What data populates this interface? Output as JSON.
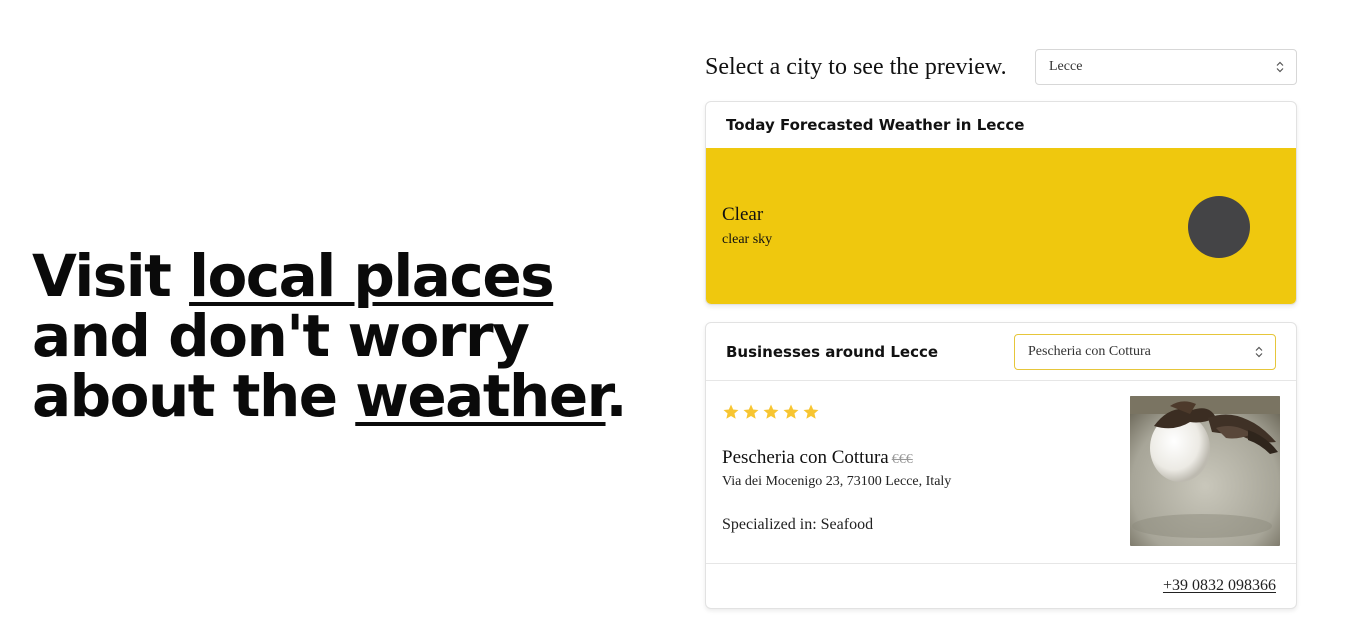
{
  "hero": {
    "line1_prefix": "Visit ",
    "line1_link": "local places",
    "line2": "and don't worry",
    "line3_prefix": "about the ",
    "line3_link": "weather",
    "line3_suffix": "."
  },
  "city_picker": {
    "label": "Select a city to see the preview.",
    "selected": "Lecce",
    "chevron_icon": "updown-chevron-icon"
  },
  "weather": {
    "title": "Today Forecasted Weather in Lecce",
    "main": "Clear",
    "description": "clear sky",
    "bg_color": "#efc80e",
    "icon": "dark-circle-icon"
  },
  "business": {
    "title": "Businesses around Lecce",
    "selected": "Pescheria con Cottura",
    "rating": 5,
    "rating_max": 5,
    "star_color": "#f7c531",
    "name": "Pescheria con Cottura",
    "price": "€€€",
    "address": "Via dei Mocenigo 23, 73100 Lecce, Italy",
    "specialized": "Specialized in: Seafood",
    "phone": "+39 0832 098366"
  }
}
